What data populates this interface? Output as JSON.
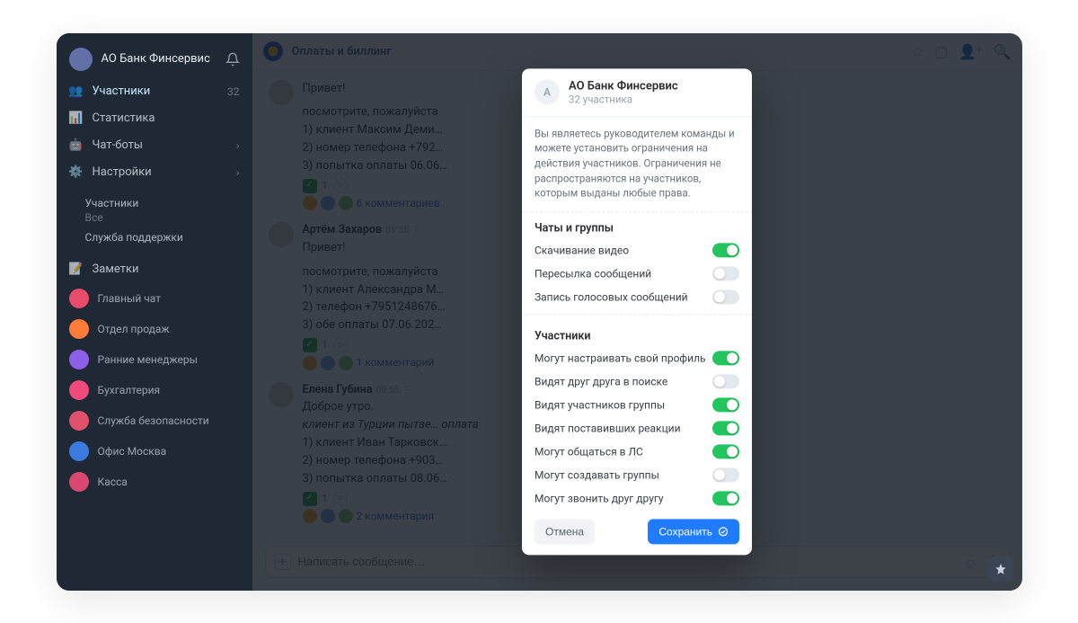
{
  "sidebar": {
    "team_name": "АО Банк Финсервис",
    "items": [
      {
        "label": "Участники",
        "count": "32"
      },
      {
        "label": "Статистика",
        "count": ""
      },
      {
        "label": "Чат-боты",
        "count": "›"
      },
      {
        "label": "Настройки",
        "count": "›"
      }
    ],
    "subsections": [
      {
        "title": "Участники",
        "sub": "Все"
      },
      {
        "title": "Служба поддержки",
        "sub": ""
      }
    ],
    "chats_label": "Заметки",
    "chats": [
      {
        "label": "Главный чат",
        "color": "#e94b6a"
      },
      {
        "label": "Отдел продаж",
        "color": "#ff7b3a"
      },
      {
        "label": "Ранние менеджеры",
        "color": "#8e5fe8"
      },
      {
        "label": "Бухгалтерия",
        "color": "#f04a7c"
      },
      {
        "label": "Служба безопасности",
        "color": "#e0506a"
      },
      {
        "label": "Офис Москва",
        "color": "#3b7be0"
      },
      {
        "label": "Касса",
        "color": "#d9486e"
      }
    ]
  },
  "chat": {
    "header_title": "Оплаты и биллинг",
    "composer_placeholder": "Написать сообщение…",
    "messages": [
      {
        "author": "",
        "text_head": "Привет!",
        "lines": [
          "посмотрите, пожалуйста",
          "1) клиент Максим Деми…",
          "2) номер телефона +792…",
          "3) попытка оплаты 06.06…"
        ],
        "rxn_count": "1",
        "thread_text": "6 комментариев"
      },
      {
        "author": "Артём Захаров",
        "time": "09:55 ⋮",
        "text_head": "Привет!",
        "lines": [
          "посмотрите, пожалуйста",
          "",
          "1) клиент Александра М…",
          "2) телефон +7951248676…",
          "3) обе оплаты 07.06.202…"
        ],
        "rxn_count": "1",
        "thread_text": "1 комментарий"
      },
      {
        "author": "Елена Губина",
        "time": "09:55 ⋮",
        "text_head": "Доброе утро.",
        "extra": "клиент из Турции пытае… оплата",
        "lines": [
          "1) клиент Иван Тарковск…",
          "2) номер телефона +903…",
          "3) попытка оплаты 08.06…"
        ],
        "rxn_count": "1",
        "thread_text": "2 комментария"
      }
    ]
  },
  "modal": {
    "avatar_letter": "А",
    "title": "АО Банк Финсервис",
    "subtitle": "32 участника",
    "description": "Вы являетесь руководителем команды и можете установить ограничения на действия участников. Ограничения не распространяются на участников, которым выданы любые права.",
    "section1_title": "Чаты и группы",
    "options1": [
      {
        "label": "Скачивание видео",
        "on": true
      },
      {
        "label": "Пересылка сообщений",
        "on": false
      },
      {
        "label": "Запись голосовых сообщений",
        "on": false
      }
    ],
    "section2_title": "Участники",
    "options2": [
      {
        "label": "Могут настраивать свой профиль",
        "on": true
      },
      {
        "label": "Видят друг друга в поиске",
        "on": false
      },
      {
        "label": "Видят участников группы",
        "on": true
      },
      {
        "label": "Видят поставивших реакции",
        "on": true
      },
      {
        "label": "Могут общаться в ЛС",
        "on": true
      },
      {
        "label": "Могут создавать группы",
        "on": false
      },
      {
        "label": "Могут звонить друг другу",
        "on": true
      }
    ],
    "cancel": "Отмена",
    "save": "Сохранить"
  }
}
